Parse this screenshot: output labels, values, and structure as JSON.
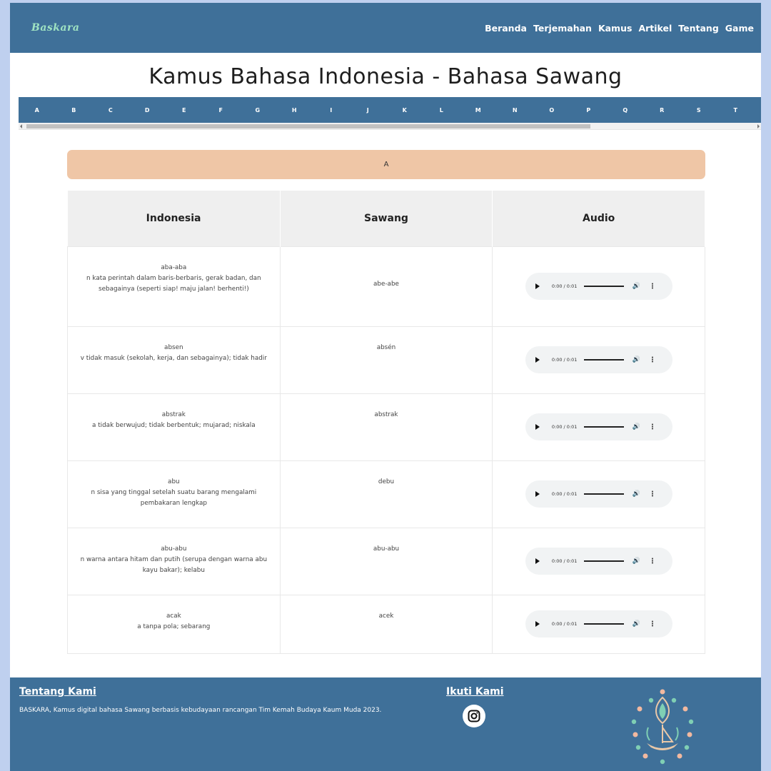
{
  "header": {
    "brand": "Baskara",
    "nav": [
      "Beranda",
      "Terjemahan",
      "Kamus",
      "Artikel",
      "Tentang",
      "Game"
    ]
  },
  "page_title": "Kamus Bahasa Indonesia - Bahasa Sawang",
  "alphabet": [
    "A",
    "B",
    "C",
    "D",
    "E",
    "F",
    "G",
    "H",
    "I",
    "J",
    "K",
    "L",
    "M",
    "N",
    "O",
    "P",
    "Q",
    "R",
    "S",
    "T"
  ],
  "current_letter": "A",
  "table": {
    "headers": [
      "Indonesia",
      "Sawang",
      "Audio"
    ],
    "rows": [
      {
        "word": "aba-aba",
        "definition": "n kata perintah dalam baris-berbaris, gerak badan, dan sebagainya (seperti siap! maju jalan! berhenti!)",
        "sawang": "abe-abe",
        "audio_time": "0:00 / 0:01"
      },
      {
        "word": "absen",
        "definition": "v tidak masuk (sekolah, kerja, dan sebagainya); tidak hadir",
        "sawang": "absén",
        "audio_time": "0:00 / 0:01"
      },
      {
        "word": "abstrak",
        "definition": "a tidak berwujud; tidak berbentuk; mujarad; niskala",
        "sawang": "abstrak",
        "audio_time": "0:00 / 0:01"
      },
      {
        "word": "abu",
        "definition": "n sisa yang tinggal setelah suatu barang mengalami pembakaran lengkap",
        "sawang": "debu",
        "audio_time": "0:00 / 0:01"
      },
      {
        "word": "abu-abu",
        "definition": "n warna antara hitam dan putih (serupa dengan warna abu kayu bakar); kelabu",
        "sawang": "abu-abu",
        "audio_time": "0:00 / 0:01"
      },
      {
        "word": "acak",
        "definition": "a tanpa pola; sebarang",
        "sawang": "acek",
        "audio_time": "0:00 / 0:01"
      }
    ]
  },
  "footer": {
    "about_title": "Tentang Kami",
    "about_text": "BASKARA, Kamus digital bahasa Sawang berbasis kebudayaan rancangan Tim Kemah Budaya Kaum Muda 2023.",
    "follow_title": "Ikuti Kami",
    "social_icon": "instagram-icon"
  },
  "colors": {
    "primary": "#3f7099",
    "accent_banner": "#efc6a6",
    "brand": "#9fe3c2",
    "page_bg": "#bfd0ef"
  }
}
